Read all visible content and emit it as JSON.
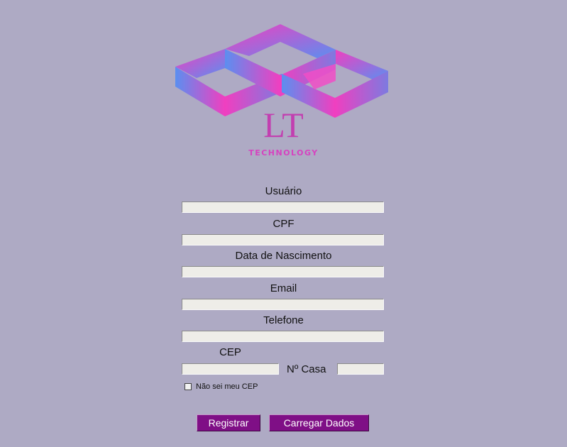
{
  "logo": {
    "letters": "LT",
    "subtitle": "TECHNOLOGY"
  },
  "form": {
    "usuario_label": "Usuário",
    "usuario_value": "",
    "cpf_label": "CPF",
    "cpf_value": "",
    "nascimento_label": "Data de Nascimento",
    "nascimento_value": "",
    "email_label": "Email",
    "email_value": "",
    "telefone_label": "Telefone",
    "telefone_value": "",
    "cep_label": "CEP",
    "cep_value": "",
    "numero_label": "Nº Casa",
    "numero_value": "",
    "checkbox_label": "Não sei meu CEP",
    "checkbox_checked": false
  },
  "buttons": {
    "register": "Registrar",
    "load": "Carregar Dados"
  },
  "colors": {
    "background": "#aeaac4",
    "button": "#7f0f86",
    "logo_text": "#c23fb0",
    "logo_pink": "#e83cc0",
    "logo_blue": "#5b8ff0"
  }
}
